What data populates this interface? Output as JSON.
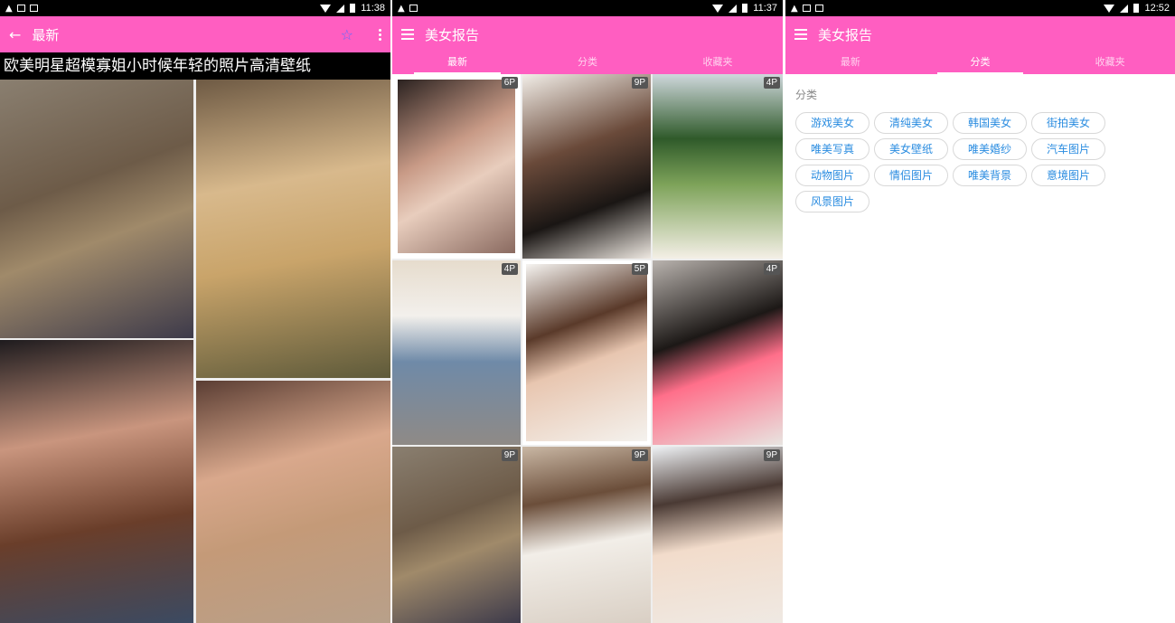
{
  "colors": {
    "accent": "#ff5ec1",
    "chip_text": "#2a8ce0",
    "star": "#5d6bff"
  },
  "screen1": {
    "status_time": "11:38",
    "appbar_title": "最新",
    "album_title": "欧美明星超模寡姐小时候年轻的照片高清壁纸"
  },
  "screen2": {
    "status_time": "11:37",
    "appbar_title": "美女报告",
    "tabs": [
      {
        "label": "最新"
      },
      {
        "label": "分类"
      },
      {
        "label": "收藏夹"
      }
    ],
    "grid": [
      {
        "badge": "6P"
      },
      {
        "badge": "9P"
      },
      {
        "badge": "4P"
      },
      {
        "badge": "4P"
      },
      {
        "badge": "5P"
      },
      {
        "badge": "4P"
      },
      {
        "badge": "9P"
      },
      {
        "badge": "9P"
      },
      {
        "badge": "9P"
      }
    ]
  },
  "screen3": {
    "status_time": "12:52",
    "appbar_title": "美女报告",
    "tabs": [
      {
        "label": "最新"
      },
      {
        "label": "分类"
      },
      {
        "label": "收藏夹"
      }
    ],
    "section_label": "分类",
    "categories": [
      {
        "label": "游戏美女"
      },
      {
        "label": "清纯美女"
      },
      {
        "label": "韩国美女"
      },
      {
        "label": "街拍美女"
      },
      {
        "label": "唯美写真"
      },
      {
        "label": "美女壁纸"
      },
      {
        "label": "唯美婚纱"
      },
      {
        "label": "汽车图片"
      },
      {
        "label": "动物图片"
      },
      {
        "label": "情侣图片"
      },
      {
        "label": "唯美背景"
      },
      {
        "label": "意境图片"
      },
      {
        "label": "风景图片"
      }
    ]
  }
}
